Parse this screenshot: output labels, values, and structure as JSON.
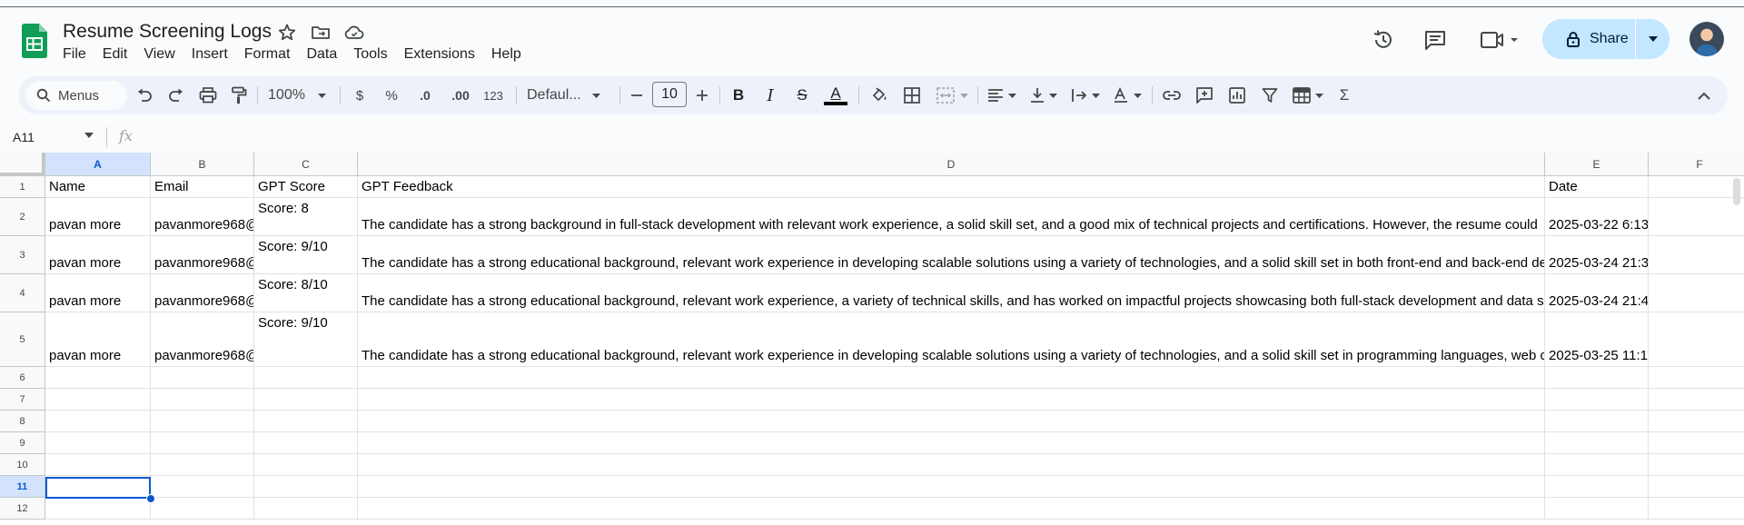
{
  "doc": {
    "title": "Resume Screening Logs"
  },
  "menu": [
    "File",
    "Edit",
    "View",
    "Insert",
    "Format",
    "Data",
    "Tools",
    "Extensions",
    "Help"
  ],
  "share": {
    "label": "Share"
  },
  "toolbar": {
    "search_label": "Menus",
    "zoom": "100%",
    "currency": "$",
    "percent": "%",
    "decrease_decimal": ".0",
    "increase_decimal": ".00",
    "more_formats": "123",
    "font_family": "Defaul...",
    "font_size": "10",
    "bold": "B",
    "italic": "I",
    "strike": "S",
    "text_color": "A",
    "sum": "Σ"
  },
  "formula_bar": {
    "name_box": "A11",
    "fx": "fx"
  },
  "columns": [
    "A",
    "B",
    "C",
    "D",
    "E",
    "F"
  ],
  "rows": [
    "1",
    "2",
    "3",
    "4",
    "5",
    "6",
    "7",
    "8",
    "9",
    "10",
    "11",
    "12"
  ],
  "header_row": {
    "name": "Name",
    "email": "Email",
    "score": "GPT Score",
    "feedback": "GPT Feedback",
    "date": "Date"
  },
  "data_rows": [
    {
      "name": "pavan more",
      "email": "pavanmore968@",
      "score": "Score: 8",
      "feedback": " The candidate has a strong background in full-stack development with relevant work experience, a solid skill set, and a good mix of technical projects and certifications. However, the resume could",
      "date": "2025-03-22 6:13"
    },
    {
      "name": "pavan more",
      "email": "pavanmore968@",
      "score": "Score: 9/10",
      "feedback": " The candidate has a strong educational background, relevant work experience in developing scalable solutions using a variety of technologies, and a solid skill set in both front-end and back-end de",
      "date": "2025-03-24 21:3"
    },
    {
      "name": "pavan more",
      "email": "pavanmore968@",
      "score": "Score: 8/10",
      "feedback": " The candidate has a strong educational background, relevant work experience, a variety of technical skills, and has worked on impactful projects showcasing both full-stack development and data s",
      "date": "2025-03-24 21:4"
    },
    {
      "name": "pavan more",
      "email": "pavanmore968@",
      "score": "Score: 9/10",
      "feedback": " The candidate has a strong educational background, relevant work experience in developing scalable solutions using a variety of technologies, and a solid skill set in programming languages, web c",
      "date": "2025-03-25 11:1"
    }
  ]
}
